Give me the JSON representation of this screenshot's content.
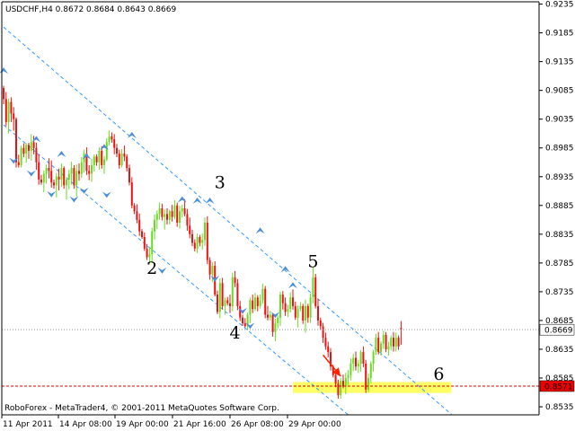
{
  "header": {
    "text": "USDCHF,H4  0.8672 0.8684 0.8643 0.8669"
  },
  "footer": {
    "text": "RoboForex - MetaTrader4, © 2001-2011 MetaQuotes Software Corp."
  },
  "colors": {
    "bull": "#66dd22",
    "bear": "#ee1111",
    "channel": "#3399ff",
    "fractal": "#4a8fd8",
    "target_zone": "#ffff66",
    "support": "#dd0000",
    "arrow": "#ff2200",
    "tag_bg": "#ffffff",
    "tag_red": "#ee0000"
  },
  "chart_data": {
    "type": "candlestick",
    "symbol": "USDCHF",
    "timeframe": "H4",
    "last_bar": {
      "open": 0.8672,
      "high": 0.8684,
      "low": 0.8643,
      "close": 0.8669
    },
    "price_labels": [
      "0.9235",
      "0.9185",
      "0.9135",
      "0.9085",
      "0.9035",
      "0.8985",
      "0.8935",
      "0.8885",
      "0.8835",
      "0.8785",
      "0.8735",
      "0.8685",
      "0.8635",
      "0.8585",
      "0.8535"
    ],
    "ylim": [
      0.8521,
      0.9239
    ],
    "time_labels": [
      "11 Apr 2011",
      "14 Apr 08:00",
      "19 Apr 00:00",
      "21 Apr 16:00",
      "26 Apr 08:00",
      "29 Apr 00:00"
    ],
    "current_price": 0.8669,
    "current_price_label": "0.8669",
    "support_level": 0.8571,
    "support_label": "0.8571",
    "target_zone": {
      "from_bar": 115,
      "to_bar": 178,
      "low": 0.8559,
      "high": 0.8578
    },
    "channel": {
      "upper": [
        [
          0,
          0.9195
        ],
        [
          178,
          0.8522
        ]
      ],
      "lower": [
        [
          0,
          0.9025
        ],
        [
          137,
          0.8521
        ]
      ]
    },
    "forecast_arrow": {
      "from": [
        127,
        0.8625
      ],
      "to": [
        134,
        0.8588
      ]
    },
    "wave_labels": [
      {
        "text": "2",
        "bar": 59,
        "price": 0.8766
      },
      {
        "text": "3",
        "bar": 86,
        "price": 0.8915
      },
      {
        "text": "4",
        "bar": 92,
        "price": 0.8654
      },
      {
        "text": "5",
        "bar": 123,
        "price": 0.8778
      },
      {
        "text": "6",
        "bar": 173,
        "price": 0.8582
      }
    ],
    "fractals_up": [
      [
        0,
        0.9117
      ],
      [
        13,
        0.8998
      ],
      [
        23,
        0.8972
      ],
      [
        33,
        0.8968
      ],
      [
        40,
        0.8984
      ],
      [
        51,
        0.9005
      ],
      [
        71,
        0.8893
      ],
      [
        77,
        0.8891
      ],
      [
        82,
        0.8891
      ],
      [
        102,
        0.8839
      ],
      [
        112,
        0.8772
      ],
      [
        115,
        0.8744
      ]
    ],
    "fractals_down": [
      [
        4,
        0.8965
      ],
      [
        11,
        0.8943
      ],
      [
        19,
        0.8907
      ],
      [
        28,
        0.8898
      ],
      [
        32,
        0.8913
      ],
      [
        41,
        0.8906
      ],
      [
        63,
        0.8774
      ],
      [
        84,
        0.876
      ],
      [
        95,
        0.8704
      ],
      [
        98,
        0.8678
      ],
      [
        108,
        0.8697
      ]
    ],
    "bars_count": 159,
    "bars": [
      [
        0.9089,
        0.9093,
        0.9061,
        0.907
      ],
      [
        0.907,
        0.9082,
        0.9023,
        0.903
      ],
      [
        0.903,
        0.9071,
        0.901,
        0.9065
      ],
      [
        0.9065,
        0.9073,
        0.903,
        0.9045
      ],
      [
        0.9045,
        0.9056,
        0.9015,
        0.9035
      ],
      [
        0.9035,
        0.9038,
        0.8951,
        0.896
      ],
      [
        0.896,
        0.8973,
        0.8951,
        0.8955
      ],
      [
        0.8955,
        0.8989,
        0.8951,
        0.8985
      ],
      [
        0.8985,
        0.8993,
        0.8969,
        0.8975
      ],
      [
        0.8975,
        0.8993,
        0.8959,
        0.899
      ],
      [
        0.899,
        0.8994,
        0.8966,
        0.898
      ],
      [
        0.898,
        0.9009,
        0.8963,
        0.8995
      ],
      [
        0.8995,
        0.9006,
        0.8974,
        0.8985
      ],
      [
        0.8985,
        0.8994,
        0.8947,
        0.896
      ],
      [
        0.896,
        0.8974,
        0.8921,
        0.893
      ],
      [
        0.893,
        0.8938,
        0.8921,
        0.8925
      ],
      [
        0.8925,
        0.8946,
        0.8908,
        0.894
      ],
      [
        0.894,
        0.8956,
        0.8923,
        0.895
      ],
      [
        0.895,
        0.8967,
        0.8932,
        0.8945
      ],
      [
        0.8945,
        0.8963,
        0.8916,
        0.8925
      ],
      [
        0.8925,
        0.893,
        0.8914,
        0.892
      ],
      [
        0.892,
        0.8941,
        0.8899,
        0.8935
      ],
      [
        0.8935,
        0.8949,
        0.8911,
        0.893
      ],
      [
        0.893,
        0.8958,
        0.8917,
        0.895
      ],
      [
        0.895,
        0.8953,
        0.8914,
        0.892
      ],
      [
        0.892,
        0.8934,
        0.8895,
        0.893
      ],
      [
        0.893,
        0.8947,
        0.8913,
        0.894
      ],
      [
        0.894,
        0.8961,
        0.8921,
        0.895
      ],
      [
        0.895,
        0.8955,
        0.8914,
        0.892
      ],
      [
        0.892,
        0.8956,
        0.89,
        0.8945
      ],
      [
        0.8945,
        0.8958,
        0.8928,
        0.894
      ],
      [
        0.894,
        0.8969,
        0.8933,
        0.896
      ],
      [
        0.896,
        0.8982,
        0.8942,
        0.8975
      ],
      [
        0.8975,
        0.8986,
        0.8938,
        0.8945
      ],
      [
        0.8945,
        0.8955,
        0.8929,
        0.894
      ],
      [
        0.894,
        0.8966,
        0.8926,
        0.8955
      ],
      [
        0.8955,
        0.8974,
        0.8944,
        0.897
      ],
      [
        0.897,
        0.8974,
        0.8954,
        0.896
      ],
      [
        0.896,
        0.8986,
        0.8947,
        0.898
      ],
      [
        0.898,
        0.8988,
        0.8949,
        0.8955
      ],
      [
        0.8955,
        0.8971,
        0.894,
        0.8965
      ],
      [
        0.8965,
        0.9002,
        0.8962,
        0.8995
      ],
      [
        0.8995,
        0.9015,
        0.8989,
        0.9005
      ],
      [
        0.9005,
        0.9012,
        0.8994,
        0.9
      ],
      [
        0.9,
        0.9009,
        0.8974,
        0.8985
      ],
      [
        0.8985,
        0.8992,
        0.8969,
        0.8975
      ],
      [
        0.8975,
        0.8982,
        0.8949,
        0.8955
      ],
      [
        0.8955,
        0.8983,
        0.8951,
        0.8975
      ],
      [
        0.8975,
        0.8989,
        0.8962,
        0.897
      ],
      [
        0.897,
        0.8974,
        0.8944,
        0.895
      ],
      [
        0.895,
        0.8956,
        0.892,
        0.8925
      ],
      [
        0.8925,
        0.8934,
        0.888,
        0.8885
      ],
      [
        0.8885,
        0.8889,
        0.887,
        0.8875
      ],
      [
        0.8875,
        0.8887,
        0.8854,
        0.886
      ],
      [
        0.886,
        0.8871,
        0.8832,
        0.884
      ],
      [
        0.884,
        0.8844,
        0.8827,
        0.883
      ],
      [
        0.883,
        0.8838,
        0.8806,
        0.881
      ],
      [
        0.881,
        0.8818,
        0.879,
        0.8795
      ],
      [
        0.8795,
        0.8813,
        0.8782,
        0.88
      ],
      [
        0.88,
        0.8846,
        0.8785,
        0.884
      ],
      [
        0.884,
        0.8869,
        0.8826,
        0.886
      ],
      [
        0.886,
        0.8876,
        0.8844,
        0.887
      ],
      [
        0.887,
        0.889,
        0.886,
        0.888
      ],
      [
        0.888,
        0.8888,
        0.8859,
        0.8865
      ],
      [
        0.8865,
        0.8878,
        0.8843,
        0.887
      ],
      [
        0.887,
        0.888,
        0.8852,
        0.886
      ],
      [
        0.886,
        0.8878,
        0.8852,
        0.8875
      ],
      [
        0.8875,
        0.8886,
        0.8857,
        0.8865
      ],
      [
        0.8865,
        0.8894,
        0.8861,
        0.8885
      ],
      [
        0.8885,
        0.889,
        0.8848,
        0.8855
      ],
      [
        0.8855,
        0.8884,
        0.8845,
        0.8875
      ],
      [
        0.8875,
        0.8886,
        0.8864,
        0.888
      ],
      [
        0.888,
        0.8896,
        0.8866,
        0.887
      ],
      [
        0.887,
        0.8879,
        0.8841,
        0.885
      ],
      [
        0.885,
        0.8864,
        0.8828,
        0.8835
      ],
      [
        0.8835,
        0.8843,
        0.8814,
        0.882
      ],
      [
        0.882,
        0.8826,
        0.8805,
        0.881
      ],
      [
        0.881,
        0.8836,
        0.8802,
        0.883
      ],
      [
        0.883,
        0.8834,
        0.8814,
        0.882
      ],
      [
        0.882,
        0.8836,
        0.8808,
        0.8825
      ],
      [
        0.8825,
        0.8864,
        0.8815,
        0.8855
      ],
      [
        0.8855,
        0.8866,
        0.8783,
        0.879
      ],
      [
        0.879,
        0.8795,
        0.8756,
        0.8765
      ],
      [
        0.8765,
        0.8786,
        0.8752,
        0.878
      ],
      [
        0.878,
        0.8788,
        0.8727,
        0.873
      ],
      [
        0.873,
        0.8737,
        0.8696,
        0.87
      ],
      [
        0.87,
        0.8758,
        0.8689,
        0.875
      ],
      [
        0.875,
        0.8759,
        0.8704,
        0.871
      ],
      [
        0.871,
        0.8725,
        0.8695,
        0.872
      ],
      [
        0.872,
        0.8726,
        0.8711,
        0.8715
      ],
      [
        0.8715,
        0.873,
        0.8698,
        0.871
      ],
      [
        0.871,
        0.8768,
        0.8701,
        0.876
      ],
      [
        0.876,
        0.8771,
        0.8743,
        0.875
      ],
      [
        0.875,
        0.8757,
        0.8703,
        0.871
      ],
      [
        0.871,
        0.8719,
        0.8684,
        0.869
      ],
      [
        0.869,
        0.8695,
        0.8676,
        0.868
      ],
      [
        0.868,
        0.8689,
        0.8673,
        0.8675
      ],
      [
        0.8675,
        0.8699,
        0.8669,
        0.8695
      ],
      [
        0.8695,
        0.8725,
        0.8681,
        0.872
      ],
      [
        0.872,
        0.873,
        0.8698,
        0.8705
      ],
      [
        0.8705,
        0.8733,
        0.8701,
        0.8725
      ],
      [
        0.8725,
        0.8729,
        0.8701,
        0.871
      ],
      [
        0.871,
        0.873,
        0.8706,
        0.872
      ],
      [
        0.872,
        0.8749,
        0.8714,
        0.874
      ],
      [
        0.874,
        0.8745,
        0.8689,
        0.8695
      ],
      [
        0.8695,
        0.871,
        0.8685,
        0.869
      ],
      [
        0.869,
        0.8702,
        0.8685,
        0.8695
      ],
      [
        0.8695,
        0.8698,
        0.8657,
        0.8665
      ],
      [
        0.8665,
        0.8688,
        0.8649,
        0.868
      ],
      [
        0.868,
        0.8694,
        0.8671,
        0.869
      ],
      [
        0.869,
        0.8735,
        0.8676,
        0.873
      ],
      [
        0.873,
        0.8736,
        0.8704,
        0.8715
      ],
      [
        0.8715,
        0.8725,
        0.8693,
        0.87
      ],
      [
        0.87,
        0.8712,
        0.8691,
        0.8705
      ],
      [
        0.8705,
        0.8734,
        0.8699,
        0.8725
      ],
      [
        0.8725,
        0.8739,
        0.8704,
        0.871
      ],
      [
        0.871,
        0.8718,
        0.8686,
        0.869
      ],
      [
        0.869,
        0.8711,
        0.8673,
        0.8705
      ],
      [
        0.8705,
        0.8717,
        0.8701,
        0.871
      ],
      [
        0.871,
        0.8714,
        0.8679,
        0.8685
      ],
      [
        0.8685,
        0.8721,
        0.8664,
        0.871
      ],
      [
        0.871,
        0.8714,
        0.8681,
        0.869
      ],
      [
        0.869,
        0.8732,
        0.8681,
        0.8725
      ],
      [
        0.8725,
        0.8778,
        0.8715,
        0.876
      ],
      [
        0.876,
        0.8766,
        0.8706,
        0.871
      ],
      [
        0.871,
        0.8723,
        0.8676,
        0.8685
      ],
      [
        0.8685,
        0.869,
        0.8669,
        0.8675
      ],
      [
        0.8675,
        0.8681,
        0.8646,
        0.8655
      ],
      [
        0.8655,
        0.8664,
        0.8634,
        0.864
      ],
      [
        0.864,
        0.8648,
        0.8621,
        0.863
      ],
      [
        0.863,
        0.8637,
        0.8598,
        0.8605
      ],
      [
        0.8605,
        0.8608,
        0.8586,
        0.859
      ],
      [
        0.859,
        0.8594,
        0.8569,
        0.8575
      ],
      [
        0.8575,
        0.8582,
        0.8549,
        0.8555
      ],
      [
        0.8555,
        0.8585,
        0.8549,
        0.858
      ],
      [
        0.858,
        0.8591,
        0.8567,
        0.857
      ],
      [
        0.857,
        0.8594,
        0.8557,
        0.8585
      ],
      [
        0.8585,
        0.8599,
        0.8573,
        0.859
      ],
      [
        0.859,
        0.8619,
        0.8581,
        0.861
      ],
      [
        0.861,
        0.8627,
        0.8597,
        0.862
      ],
      [
        0.862,
        0.8631,
        0.8598,
        0.8605
      ],
      [
        0.8605,
        0.8616,
        0.8594,
        0.861
      ],
      [
        0.861,
        0.8634,
        0.8596,
        0.863
      ],
      [
        0.863,
        0.864,
        0.8604,
        0.861
      ],
      [
        0.861,
        0.8616,
        0.8559,
        0.8565
      ],
      [
        0.8565,
        0.8593,
        0.856,
        0.8585
      ],
      [
        0.8585,
        0.8614,
        0.8576,
        0.861
      ],
      [
        0.861,
        0.8634,
        0.8596,
        0.863
      ],
      [
        0.863,
        0.8662,
        0.8625,
        0.8655
      ],
      [
        0.8655,
        0.8665,
        0.8626,
        0.863
      ],
      [
        0.863,
        0.8649,
        0.8624,
        0.8645
      ],
      [
        0.8645,
        0.8667,
        0.8636,
        0.866
      ],
      [
        0.866,
        0.8665,
        0.863,
        0.8635
      ],
      [
        0.8635,
        0.8648,
        0.8624,
        0.864
      ],
      [
        0.864,
        0.8659,
        0.8633,
        0.8655
      ],
      [
        0.8655,
        0.8665,
        0.8631,
        0.864
      ],
      [
        0.864,
        0.8664,
        0.8631,
        0.8655
      ],
      [
        0.8655,
        0.8659,
        0.8634,
        0.864
      ],
      [
        0.8672,
        0.8684,
        0.8643,
        0.8669
      ]
    ]
  }
}
